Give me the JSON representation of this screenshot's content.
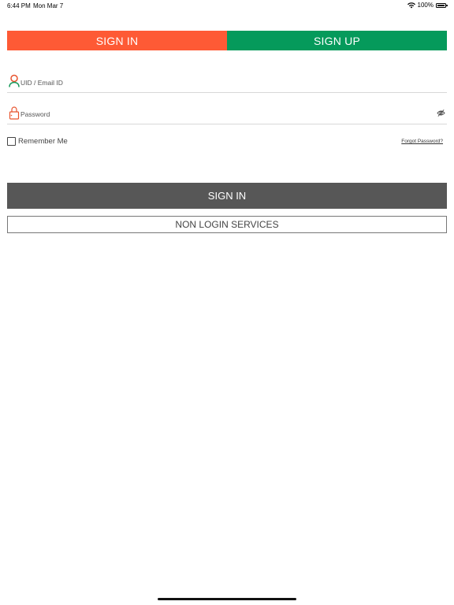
{
  "status_bar": {
    "time": "6:44 PM",
    "date": "Mon Mar 7",
    "battery": "100%",
    "battery_level": 1.0
  },
  "tabs": [
    {
      "label": "SIGN IN",
      "color": "#fe5a35",
      "active": true
    },
    {
      "label": "SIGN UP",
      "color": "#059a5b",
      "active": false
    }
  ],
  "form": {
    "uid_placeholder": "UID / Email ID",
    "uid_value": "",
    "password_placeholder": "Password",
    "password_value": "",
    "remember_label": "Remember Me",
    "remember_checked": false,
    "forgot_label": "Forgot Password?"
  },
  "buttons": {
    "sign_in": "SIGN IN",
    "non_login": "NON LOGIN SERVICES"
  },
  "icons": {
    "uid": "user-icon",
    "password": "lock-icon",
    "toggle_visibility": "eye-slash-icon",
    "wifi": "wifi-icon",
    "battery": "battery-icon"
  },
  "colors": {
    "accent_orange": "#fe5a35",
    "accent_green": "#059a5b",
    "button_dark": "#575757"
  }
}
